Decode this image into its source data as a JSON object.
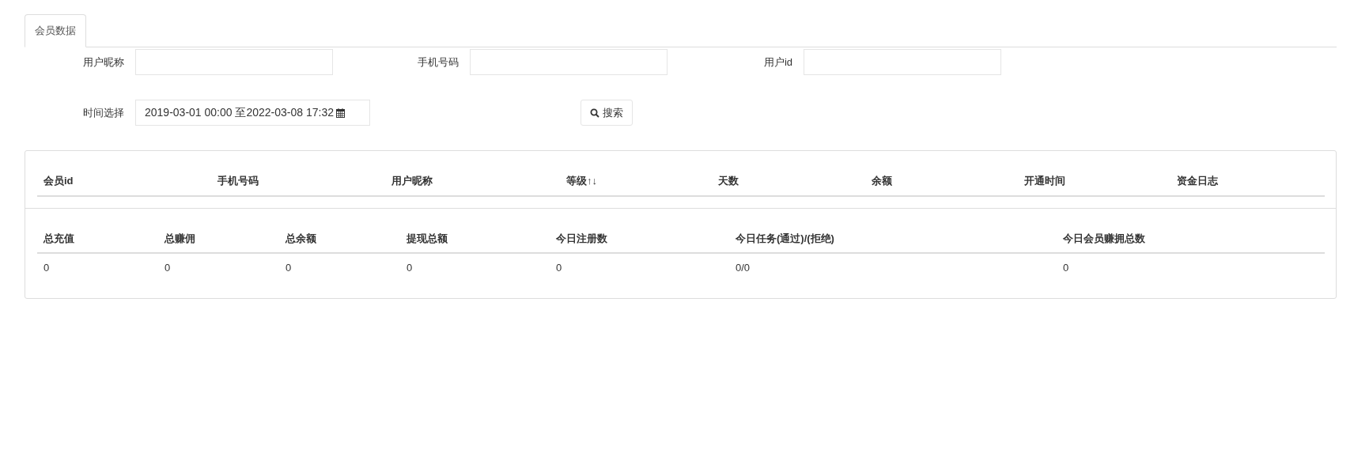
{
  "tabs": [
    {
      "label": "会员数据",
      "selected": true
    }
  ],
  "filters": [
    {
      "label": "用户昵称",
      "kind": "text"
    },
    {
      "label": "手机号码",
      "kind": "text"
    },
    {
      "label": "用户id",
      "kind": "text"
    },
    {
      "label": "时间选择",
      "kind": "daterange",
      "value": "2019-03-01 00:00 至2022-03-08 17:32"
    }
  ],
  "search_button": {
    "label": "搜索"
  },
  "members_table": {
    "columns": [
      "会员id",
      "手机号码",
      "用户昵称",
      "等级↑↓",
      "天数",
      "余额",
      "开通时间",
      "资金日志"
    ]
  },
  "summary_table": {
    "columns": [
      "总充值",
      "总赚佣",
      "总余额",
      "提现总额",
      "今日注册数",
      "今日任务(通过)/(拒绝)",
      "今日会员赚拥总数"
    ],
    "rows": [
      [
        "0",
        "0",
        "0",
        "0",
        "0",
        "0/0",
        "0"
      ]
    ]
  }
}
